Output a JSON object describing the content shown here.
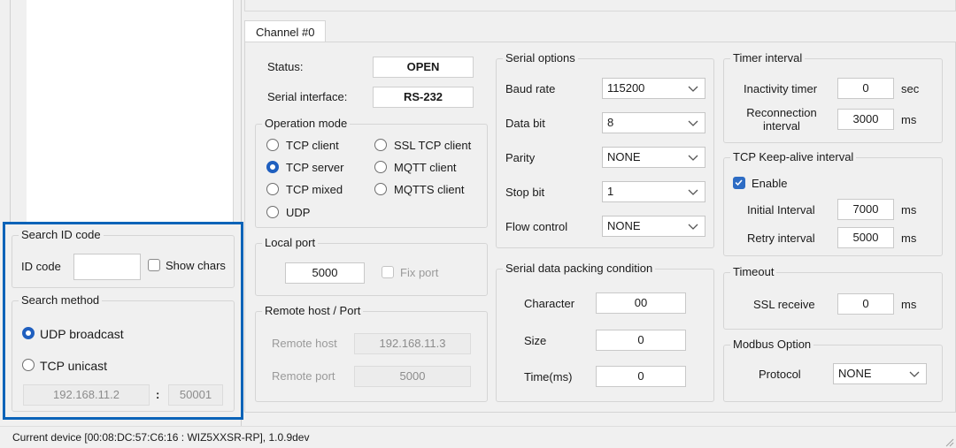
{
  "channel_tab": "Channel #0",
  "status": {
    "label": "Status:",
    "value": "OPEN"
  },
  "serial_interface": {
    "label": "Serial interface:",
    "value": "RS-232"
  },
  "operation_mode": {
    "title": "Operation mode",
    "options": [
      "TCP client",
      "TCP server",
      "TCP mixed",
      "UDP",
      "SSL TCP client",
      "MQTT client",
      "MQTTS client"
    ],
    "selected": "TCP server"
  },
  "local_port": {
    "title": "Local port",
    "value": "5000",
    "fix_port_label": "Fix port"
  },
  "remote_host_port": {
    "title": "Remote host / Port",
    "host_label": "Remote host",
    "host_value": "192.168.11.3",
    "port_label": "Remote port",
    "port_value": "5000"
  },
  "serial_options": {
    "title": "Serial options",
    "baud_rate_label": "Baud rate",
    "baud_rate_value": "115200",
    "data_bit_label": "Data bit",
    "data_bit_value": "8",
    "parity_label": "Parity",
    "parity_value": "NONE",
    "stop_bit_label": "Stop bit",
    "stop_bit_value": "1",
    "flow_control_label": "Flow control",
    "flow_control_value": "NONE"
  },
  "packing": {
    "title": "Serial data packing condition",
    "character_label": "Character",
    "character_value": "00",
    "size_label": "Size",
    "size_value": "0",
    "time_label": "Time(ms)",
    "time_value": "0"
  },
  "timer_interval": {
    "title": "Timer interval",
    "inactivity_label": "Inactivity timer",
    "inactivity_value": "0",
    "inactivity_unit": "sec",
    "reconnection_label_1": "Reconnection",
    "reconnection_label_2": "interval",
    "reconnection_value": "3000",
    "reconnection_unit": "ms"
  },
  "keepalive": {
    "title": "TCP Keep-alive interval",
    "enable_label": "Enable",
    "initial_label": "Initial Interval",
    "initial_value": "7000",
    "initial_unit": "ms",
    "retry_label": "Retry interval",
    "retry_value": "5000",
    "retry_unit": "ms"
  },
  "timeout": {
    "title": "Timeout",
    "ssl_label": "SSL receive",
    "ssl_value": "0",
    "ssl_unit": "ms"
  },
  "modbus": {
    "title": "Modbus Option",
    "protocol_label": "Protocol",
    "protocol_value": "NONE"
  },
  "search_id": {
    "title": "Search ID code",
    "id_label": "ID code",
    "id_value": "",
    "show_chars_label": "Show chars"
  },
  "search_method": {
    "title": "Search method",
    "udp_label": "UDP broadcast",
    "tcp_label": "TCP unicast",
    "ip_value": "192.168.11.2",
    "separator": ":",
    "port_value": "50001"
  },
  "status_bar": "Current device [00:08:DC:57:C6:16 : WIZ5XXSR-RP], 1.0.9dev",
  "colors": {
    "highlight_border": "#0a63b8",
    "accent": "#1f5fbf"
  }
}
